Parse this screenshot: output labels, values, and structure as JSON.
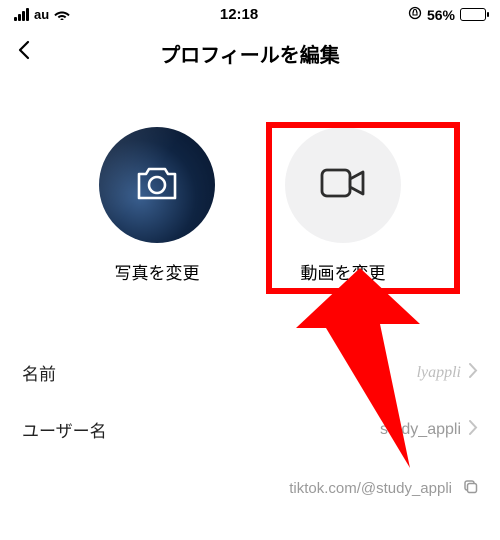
{
  "status": {
    "carrier": "au",
    "time": "12:18",
    "battery_pct": "56%"
  },
  "header": {
    "title": "プロフィールを編集"
  },
  "avatars": {
    "photo_label": "写真を変更",
    "video_label": "動画を変更"
  },
  "rows": {
    "name_label": "名前",
    "name_value": "lyappli",
    "username_label": "ユーザー名",
    "username_value": "study_appli",
    "profile_url": "tiktok.com/@study_appli"
  },
  "annotation": {
    "highlight_color": "#ff0000"
  }
}
